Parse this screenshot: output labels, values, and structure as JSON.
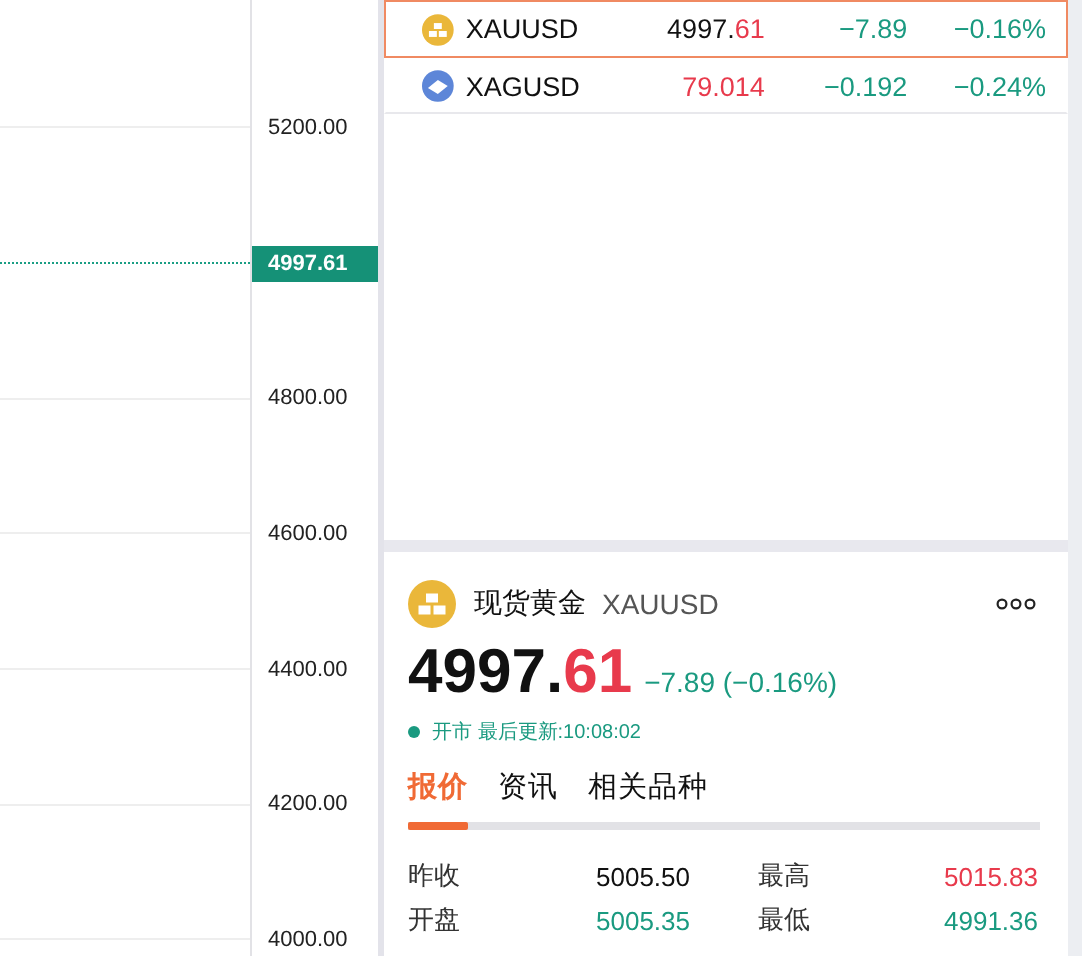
{
  "price_axis": [
    {
      "kind": "tick",
      "label": "5200.00"
    },
    {
      "kind": "current",
      "label": "4997.61"
    },
    {
      "kind": "tick",
      "label": "4800.00"
    },
    {
      "kind": "tick",
      "label": "4600.00"
    },
    {
      "kind": "tick",
      "label": "4400.00"
    },
    {
      "kind": "tick",
      "label": "4200.00"
    },
    {
      "kind": "tick",
      "label": "4000.00"
    }
  ],
  "watchlist": [
    {
      "kind": "gold",
      "symbol": "XAUUSD",
      "price_head": "4997.",
      "price_tail": "61",
      "change": "−7.89",
      "percent": "−0.16%",
      "color": "#1a9a80",
      "selected": true
    },
    {
      "kind": "silver",
      "symbol": "XAGUSD",
      "price_tail": "79.014",
      "change": "−0.192",
      "percent": "−0.24%",
      "color": "#1a9a80",
      "selected": false
    }
  ],
  "detail": {
    "kind": "gold",
    "name": "现货黄金",
    "symbol": "XAUUSD",
    "price_head": "4997.",
    "price_tail": "61",
    "change": "−7.89 (−0.16%)",
    "color": "#1a9a80",
    "market_open": true,
    "status": "开市 最后更新:10:08:02",
    "tabs": [
      {
        "label": "报价",
        "selected": true
      },
      {
        "label": "资讯",
        "selected": false
      },
      {
        "label": "相关品种",
        "selected": false
      }
    ],
    "stats": [
      {
        "label": "昨收",
        "value": "5005.50",
        "color": "#111111"
      },
      {
        "label": "最高",
        "value": "5015.83",
        "color": "#e83a4c"
      },
      {
        "label": "开盘",
        "value": "5005.35",
        "color": "#1a9a80"
      },
      {
        "label": "最低",
        "value": "4991.36",
        "color": "#1a9a80"
      }
    ]
  }
}
